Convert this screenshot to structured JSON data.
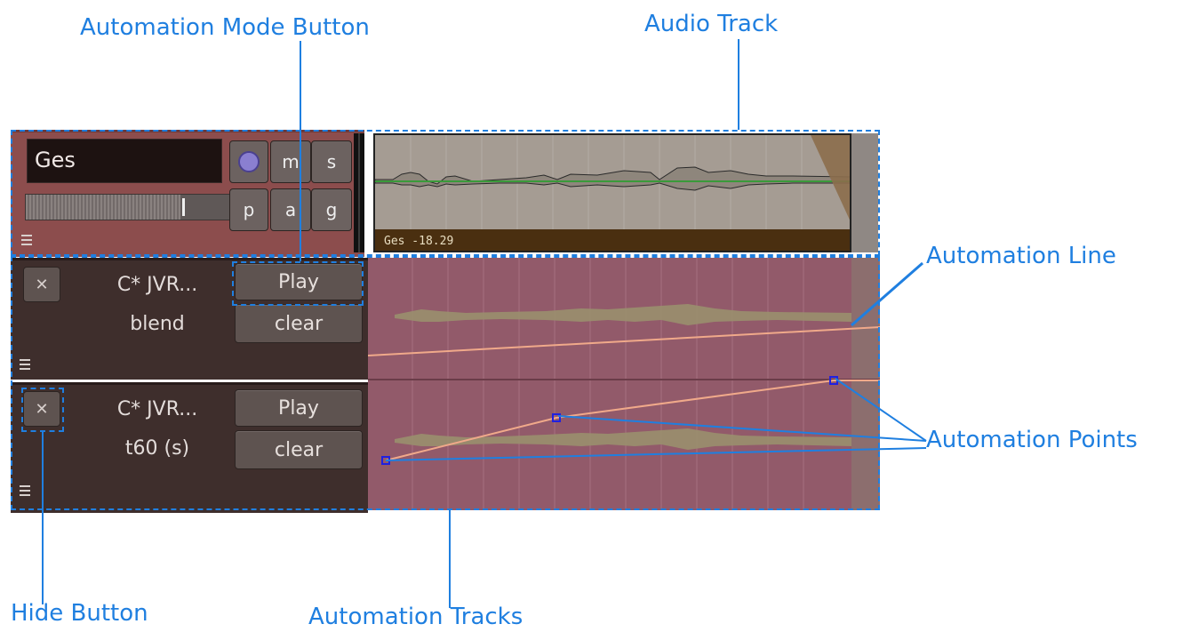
{
  "callouts": {
    "automation_mode_button": "Automation Mode Button",
    "audio_track": "Audio Track",
    "automation_line": "Automation Line",
    "automation_points": "Automation Points",
    "hide_button": "Hide Button",
    "automation_tracks": "Automation Tracks"
  },
  "audio_track": {
    "name": "Ges",
    "buttons": {
      "mute": "m",
      "solo": "s",
      "playlist": "p",
      "automation": "a",
      "group": "g"
    },
    "region_label": "Ges -18.29"
  },
  "automation_tracks": [
    {
      "plugin": "C* JVR...",
      "param": "blend",
      "mode": "Play",
      "clear": "clear",
      "hide_icon": "close-x-icon"
    },
    {
      "plugin": "C* JVR...",
      "param": "t60 (s)",
      "mode": "Play",
      "clear": "clear",
      "hide_icon": "close-x-icon"
    }
  ],
  "colors": {
    "callout_blue": "#1f7fe0",
    "automation_line": "#f0a98a",
    "region_bg": "#a59c93",
    "automation_bg": "#925a6a",
    "header_bg": "#8c4d4d"
  }
}
